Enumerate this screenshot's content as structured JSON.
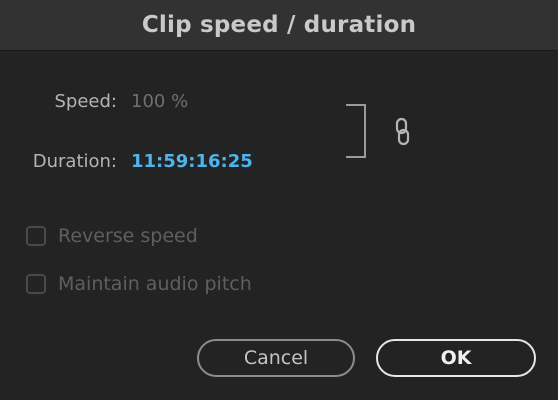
{
  "dialog": {
    "title": "Clip speed / duration"
  },
  "speed": {
    "label": "Speed:",
    "value": "100 %"
  },
  "duration": {
    "label": "Duration:",
    "value": "11:59:16:25"
  },
  "link": {
    "icon": "chain-link-icon",
    "linked": true
  },
  "options": {
    "reverse_speed": {
      "label": "Reverse speed",
      "checked": false,
      "enabled": false
    },
    "maintain_pitch": {
      "label": "Maintain audio pitch",
      "checked": false,
      "enabled": false
    }
  },
  "buttons": {
    "cancel": "Cancel",
    "ok": "OK"
  },
  "colors": {
    "background": "#232323",
    "title_bar": "#323232",
    "duration_accent": "#4fb4ec"
  }
}
